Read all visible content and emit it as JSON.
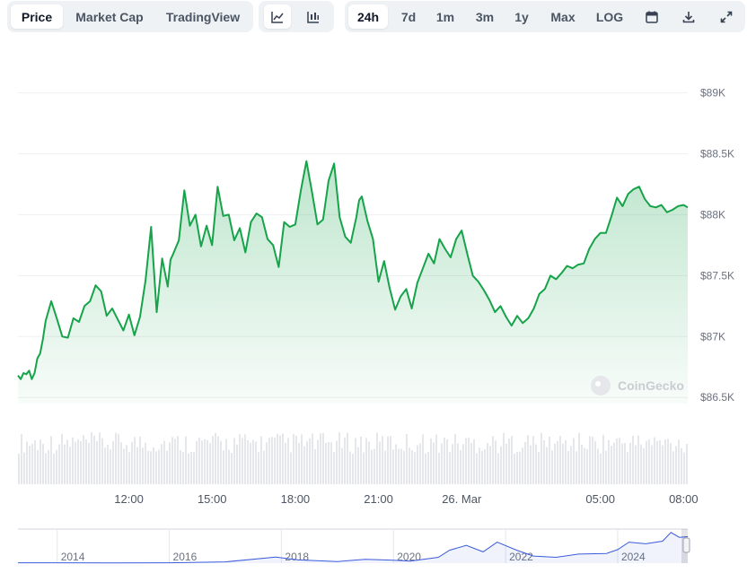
{
  "toolbar": {
    "tabs": [
      "Price",
      "Market Cap",
      "TradingView"
    ],
    "ranges": [
      "24h",
      "7d",
      "1m",
      "3m",
      "1y",
      "Max",
      "LOG"
    ],
    "active_tab": "Price",
    "active_range": "24h",
    "active_chart_style": "line",
    "icons": [
      "line-chart-icon",
      "candlestick-icon",
      "calendar-icon",
      "download-icon",
      "fullscreen-icon"
    ]
  },
  "watermark": "CoinGecko",
  "colors": {
    "line": "#16a34a",
    "fill": "#16a34a",
    "volume": "#e5e7eb",
    "navigator_line": "#3b5bdb"
  },
  "chart_data": {
    "type": "line",
    "title": "",
    "xlabel": "",
    "ylabel": "",
    "y_tick_labels": [
      "$89K",
      "$88.5K",
      "$88K",
      "$87.5K",
      "$87K",
      "$86.5K"
    ],
    "y_ticks": [
      89000,
      88500,
      88000,
      87500,
      87000,
      86500
    ],
    "ylim": [
      86450,
      89100
    ],
    "x_tick_labels": [
      "12:00",
      "15:00",
      "18:00",
      "21:00",
      "26. Mar",
      "05:00",
      "08:00"
    ],
    "x_tick_hours": [
      12,
      15,
      18,
      21,
      24,
      29,
      32
    ],
    "xlim_hours": [
      8.0,
      32.15
    ],
    "grid": true,
    "series": [
      {
        "x_hours": [
          8.0,
          8.1,
          8.2,
          8.3,
          8.4,
          8.5,
          8.6,
          8.7,
          8.8,
          8.9,
          9.0,
          9.2,
          9.4,
          9.6,
          9.8,
          10.0,
          10.2,
          10.4,
          10.6,
          10.8,
          11.0,
          11.2,
          11.4,
          11.6,
          11.8,
          12.0,
          12.2,
          12.4,
          12.6,
          12.8,
          13.0,
          13.2,
          13.4,
          13.5,
          13.6,
          13.8,
          14.0,
          14.2,
          14.4,
          14.6,
          14.8,
          15.0,
          15.2,
          15.4,
          15.6,
          15.8,
          16.0,
          16.2,
          16.4,
          16.6,
          16.8,
          17.0,
          17.2,
          17.4,
          17.6,
          17.8,
          18.0,
          18.2,
          18.4,
          18.6,
          18.8,
          19.0,
          19.2,
          19.4,
          19.6,
          19.8,
          20.0,
          20.2,
          20.3,
          20.4,
          20.6,
          20.8,
          21.0,
          21.2,
          21.4,
          21.6,
          21.8,
          22.0,
          22.2,
          22.4,
          22.6,
          22.8,
          23.0,
          23.2,
          23.4,
          23.6,
          23.8,
          24.0,
          24.2,
          24.4,
          24.6,
          24.8,
          25.0,
          25.2,
          25.4,
          25.6,
          25.8,
          26.0,
          26.2,
          26.4,
          26.6,
          26.8,
          27.0,
          27.2,
          27.4,
          27.6,
          27.8,
          28.0,
          28.2,
          28.4,
          28.6,
          28.8,
          29.0,
          29.2,
          29.4,
          29.6,
          29.8,
          30.0,
          30.2,
          30.4,
          30.6,
          30.8,
          31.0,
          31.2,
          31.4,
          31.6,
          31.8,
          32.0,
          32.15
        ],
        "values": [
          86680,
          86650,
          86700,
          86690,
          86720,
          86650,
          86700,
          86820,
          86860,
          86980,
          87130,
          87290,
          87150,
          87000,
          86990,
          87150,
          87120,
          87250,
          87290,
          87420,
          87370,
          87170,
          87230,
          87140,
          87050,
          87180,
          87010,
          87160,
          87460,
          87900,
          87200,
          87640,
          87410,
          87630,
          87680,
          87790,
          88200,
          87910,
          88000,
          87740,
          87910,
          87750,
          88230,
          87990,
          88000,
          87790,
          87890,
          87690,
          87940,
          88010,
          87980,
          87800,
          87750,
          87570,
          87940,
          87900,
          87920,
          88200,
          88440,
          88190,
          87920,
          87960,
          88280,
          88420,
          87980,
          87820,
          87770,
          87980,
          88120,
          88150,
          87950,
          87800,
          87450,
          87620,
          87400,
          87220,
          87330,
          87390,
          87230,
          87440,
          87560,
          87680,
          87600,
          87800,
          87720,
          87650,
          87800,
          87870,
          87680,
          87500,
          87450,
          87380,
          87300,
          87200,
          87250,
          87160,
          87090,
          87170,
          87110,
          87150,
          87230,
          87350,
          87390,
          87500,
          87470,
          87520,
          87580,
          87560,
          87590,
          87600,
          87720,
          87800,
          87850,
          87850,
          87990,
          88140,
          88070,
          88170,
          88210,
          88230,
          88130,
          88070,
          88060,
          88080,
          88020,
          88040,
          88070,
          88080,
          88060
        ],
        "name": ""
      }
    ],
    "navigator": {
      "tick_labels": [
        "2014",
        "2016",
        "2018",
        "2020",
        "2022",
        "2024"
      ],
      "tick_years": [
        2014,
        2016,
        2018,
        2020,
        2022,
        2024
      ],
      "xlim_years": [
        2013.3,
        2025.25
      ],
      "years": [
        2013.3,
        2014.0,
        2015.0,
        2016.0,
        2017.0,
        2017.9,
        2018.3,
        2019.0,
        2019.5,
        2020.0,
        2020.3,
        2020.8,
        2021.0,
        2021.3,
        2021.6,
        2021.85,
        2022.2,
        2022.5,
        2022.9,
        2023.3,
        2023.8,
        2024.0,
        2024.2,
        2024.5,
        2024.8,
        2024.95,
        2025.1,
        2025.25
      ],
      "values": [
        0.01,
        0.01,
        0.005,
        0.01,
        0.04,
        0.19,
        0.1,
        0.05,
        0.12,
        0.09,
        0.06,
        0.18,
        0.4,
        0.55,
        0.35,
        0.65,
        0.4,
        0.22,
        0.18,
        0.28,
        0.3,
        0.42,
        0.65,
        0.6,
        0.68,
        0.95,
        0.8,
        0.82
      ]
    }
  }
}
